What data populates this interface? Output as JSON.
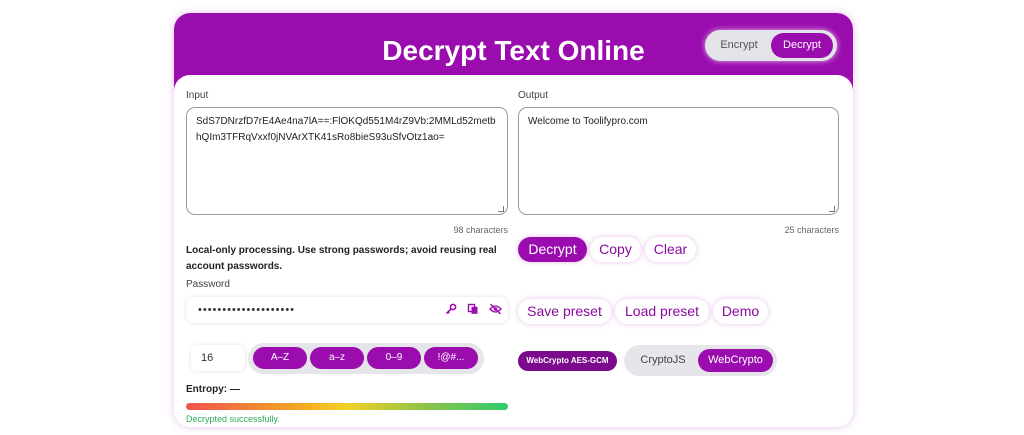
{
  "header": {
    "title": "Decrypt Text Online",
    "modes": [
      "Encrypt",
      "Decrypt"
    ],
    "active_mode": "Decrypt"
  },
  "input": {
    "label": "Input",
    "value": "SdS7DNrzfD7rE4Ae4na7lA==:FlOKQd551M4rZ9Vb:2MMLd52metbhQIm3TFRqVxxf0jNVArXTK41sRo8bieS93uSfvOtz1ao=",
    "count": "98 characters"
  },
  "output": {
    "label": "Output",
    "value": "Welcome to Toolifypro.com",
    "count": "25 characters"
  },
  "notice": "Local-only processing. Use strong passwords; avoid reusing real account passwords.",
  "password": {
    "label": "Password",
    "masked_value": "••••••••••••••••••••",
    "icons": [
      "key-icon",
      "copy-icon",
      "eye-off-icon"
    ]
  },
  "generator": {
    "length": "16",
    "charsets": [
      "A–Z",
      "a–z",
      "0–9",
      "!@#..."
    ]
  },
  "entropy": {
    "label": "Entropy: —"
  },
  "status": "Decrypted successfully.",
  "actions": {
    "decrypt": "Decrypt",
    "copy": "Copy",
    "clear": "Clear"
  },
  "presets": {
    "save": "Save preset",
    "load": "Load preset",
    "demo": "Demo"
  },
  "engine": {
    "badge": "WebCrypto AES-GCM",
    "options": [
      "CryptoJS",
      "WebCrypto"
    ],
    "active": "WebCrypto"
  },
  "colors": {
    "accent": "#9a0cae",
    "success": "#2eaa5c"
  }
}
